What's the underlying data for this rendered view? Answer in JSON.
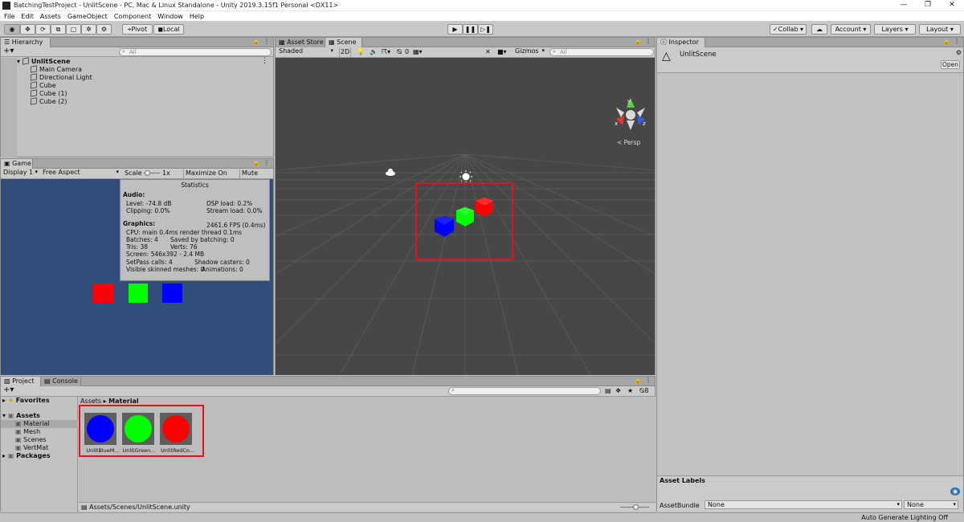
{
  "window": {
    "title": "BatchingTestProject - UnlitScene - PC, Mac & Linux Standalone - Unity 2019.3.15f1 Personal <DX11>",
    "controls": [
      "minimize-icon",
      "maximize-icon",
      "close-icon"
    ]
  },
  "menu": [
    "File",
    "Edit",
    "Assets",
    "GameObject",
    "Component",
    "Window",
    "Help"
  ],
  "toolbar": {
    "pivot": "Pivot",
    "local": "Local",
    "collab": "Collab",
    "account": "Account",
    "layers": "Layers",
    "layout": "Layout"
  },
  "hierarchy": {
    "tab": "Hierarchy",
    "search_placeholder": "All",
    "scene": "UnlitScene",
    "items": [
      "Main Camera",
      "Directional Light",
      "Cube",
      "Cube (1)",
      "Cube (2)"
    ]
  },
  "game": {
    "tab": "Game",
    "display": "Display 1",
    "aspect": "Free Aspect",
    "scale_label": "Scale",
    "scale_value": "1x",
    "maximize": "Maximize On Play",
    "mute": "Mute Audio",
    "colors": {
      "red": "#ff0000",
      "green": "#00ff00",
      "blue": "#0000ff",
      "background": "#314d79"
    },
    "stats": {
      "title": "Statistics",
      "audio_header": "Audio:",
      "level": "Level: -74.8 dB",
      "dsp": "DSP load: 0.2%",
      "clipping": "Clipping: 0.0%",
      "stream": "Stream load: 0.0%",
      "graphics_header": "Graphics:",
      "fps": "2461.6 FPS (0.4ms)",
      "cpu": "CPU: main 0.4ms  render thread 0.1ms",
      "batches": "Batches: 4",
      "saved": "Saved by batching: 0",
      "tris": "Tris: 38",
      "verts": "Verts: 76",
      "screen": "Screen: 546x392 - 2.4 MB",
      "setpass": "SetPass calls: 4",
      "shadow": "Shadow casters: 0",
      "skinned": "Visible skinned meshes: 0",
      "animations": "Animations: 0"
    }
  },
  "scene": {
    "tab_asset_store": "Asset Store",
    "tab_scene": "Scene",
    "shading": "Shaded",
    "mode_2d": "2D",
    "hidden_count": "0",
    "gizmos": "Gizmos",
    "search_placeholder": "All",
    "persp": "< Persp",
    "axis_x": "x",
    "axis_y": "y",
    "axis_z": "z",
    "highlight_color": "#e0141e"
  },
  "inspector": {
    "tab": "Inspector",
    "object": "UnlitScene",
    "open": "Open",
    "asset_labels": "Asset Labels",
    "assetbundle_label": "AssetBundle",
    "assetbundle_value": "None",
    "variant_value": "None"
  },
  "project": {
    "tab_project": "Project",
    "tab_console": "Console",
    "favorites": "Favorites",
    "assets": "Assets",
    "folders": [
      "Material",
      "Mesh",
      "Scenes",
      "VertMat"
    ],
    "packages": "Packages",
    "breadcrumb_root": "Assets",
    "breadcrumb_current": "Material",
    "items": [
      {
        "name": "UnlitBlueM...",
        "color": "#0000ff"
      },
      {
        "name": "UnlitGreen...",
        "color": "#00ff00"
      },
      {
        "name": "UnlitRedCo...",
        "color": "#ff0000"
      }
    ],
    "path": "Assets/Scenes/UnlitScene.unity",
    "count": "8"
  },
  "status": {
    "text": "Auto Generate Lighting Off"
  }
}
